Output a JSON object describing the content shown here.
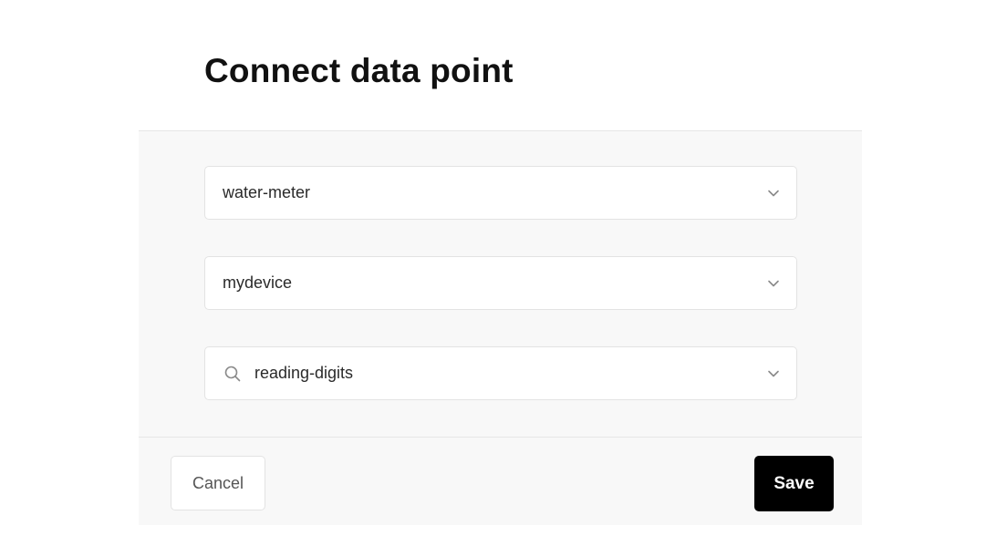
{
  "dialog": {
    "title": "Connect data point"
  },
  "form": {
    "fields": [
      {
        "value": "water-meter",
        "icon": "chevron-down-icon"
      },
      {
        "value": "mydevice",
        "icon": "chevron-down-icon"
      },
      {
        "value": "reading-digits",
        "leading_icon": "search-icon",
        "icon": "chevron-down-icon"
      }
    ]
  },
  "footer": {
    "cancel_label": "Cancel",
    "save_label": "Save"
  },
  "colors": {
    "primary_button": "#000000",
    "body_background": "#f8f8f8",
    "border": "#e3e3e3"
  }
}
